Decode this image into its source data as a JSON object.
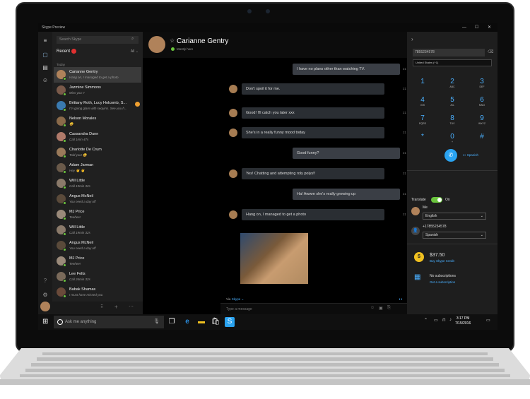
{
  "window": {
    "title": "Skype Preview",
    "controls": [
      "—",
      "☐",
      "✕"
    ]
  },
  "rail": {
    "icons": [
      "menu-icon",
      "chat-icon",
      "contacts-icon",
      "group-icon"
    ]
  },
  "convlist": {
    "search_placeholder": "Search Skype",
    "recent_label": "Recent",
    "filter_label": "All ⌄",
    "today_label": "Today",
    "items": [
      {
        "name": "Carianne Gentry",
        "msg": "Hang on, I managed to get a photo"
      },
      {
        "name": "Jazmine Simmons",
        "msg": "Miss you !!"
      },
      {
        "name": "Brittany Roth, Lucy Holcomb, S...",
        "msg": "I'm going glam with sequins. See you h..."
      },
      {
        "name": "Nelson Morales",
        "msg": "😀"
      },
      {
        "name": "Cassandra Dunn",
        "msg": "Call 1min 47s"
      },
      {
        "name": "Charlotte De Crum",
        "msg": "Told you! 😀"
      },
      {
        "name": "Adam Jarman",
        "msg": "Hey 👋 👋"
      },
      {
        "name": "Will Little",
        "msg": "Call 19min 32s"
      },
      {
        "name": "Angus McNeil",
        "msg": "You need a day off"
      },
      {
        "name": "MJ Price",
        "msg": "Teehee!"
      },
      {
        "name": "Will Little",
        "msg": "Call 19min 32s"
      },
      {
        "name": "Angus McNeil",
        "msg": "You need a day off"
      },
      {
        "name": "MJ Price",
        "msg": "Teehee!"
      },
      {
        "name": "Lee Felts",
        "msg": "Call 26min 32s"
      },
      {
        "name": "Babak Shamas",
        "msg": "I must have missed you"
      }
    ],
    "unread_count": "2"
  },
  "chat": {
    "name": "Carianne Gentry",
    "status": "Mostly here",
    "messages": [
      {
        "text": "I have no plans other than watching TV.",
        "dir": "out",
        "time": "21"
      },
      {
        "text": "Don't spoil it for me.",
        "dir": "in",
        "time": "21"
      },
      {
        "text": "Good! I'll catch you later xxx",
        "dir": "in",
        "time": "21"
      },
      {
        "text": "She's in a really funny mood today",
        "dir": "in",
        "time": "21"
      },
      {
        "text": "Good funny?",
        "dir": "out",
        "time": "21"
      },
      {
        "text": "Yes! Chatting and attempting roly polys!!",
        "dir": "in",
        "time": "21"
      },
      {
        "text": "Ha! Awwm she's really growing up",
        "dir": "out",
        "time": "21"
      },
      {
        "text": "Hang on, I managed to get a photo",
        "dir": "in",
        "time": "21"
      }
    ],
    "via_prefix": "Via",
    "via_value": "Skype ⌄",
    "composer_placeholder": "Type a message"
  },
  "dialpad": {
    "number": "7855234578",
    "country": "United States (+1)",
    "keys": [
      {
        "d": "1",
        "l": ""
      },
      {
        "d": "2",
        "l": "ABC"
      },
      {
        "d": "3",
        "l": "DEF"
      },
      {
        "d": "4",
        "l": "GHI"
      },
      {
        "d": "5",
        "l": "JKL"
      },
      {
        "d": "6",
        "l": "MNO"
      },
      {
        "d": "7",
        "l": "PQRS"
      },
      {
        "d": "8",
        "l": "TUV"
      },
      {
        "d": "9",
        "l": "WXYZ"
      },
      {
        "d": "*",
        "l": ""
      },
      {
        "d": "0",
        "l": "+"
      },
      {
        "d": "#",
        "l": ""
      }
    ],
    "call_label": "Spanish",
    "translate_label": "Translate",
    "toggle_label": "On",
    "me_label": "Me",
    "me_lang": "English",
    "other_number": "+17855234578",
    "other_lang": "Spanish",
    "credit_amount": "$37.50",
    "credit_link": "Buy Skype Credit",
    "subs_label": "No subscriptions",
    "subs_link": "Get a subscription"
  },
  "taskbar": {
    "search_placeholder": "Ask me anything",
    "time": "3:17 PM",
    "date": "7/15/2016"
  },
  "colors": {
    "accent": "#2aa3f0",
    "online": "#6ac43d",
    "bubble": "#2a2e33"
  }
}
